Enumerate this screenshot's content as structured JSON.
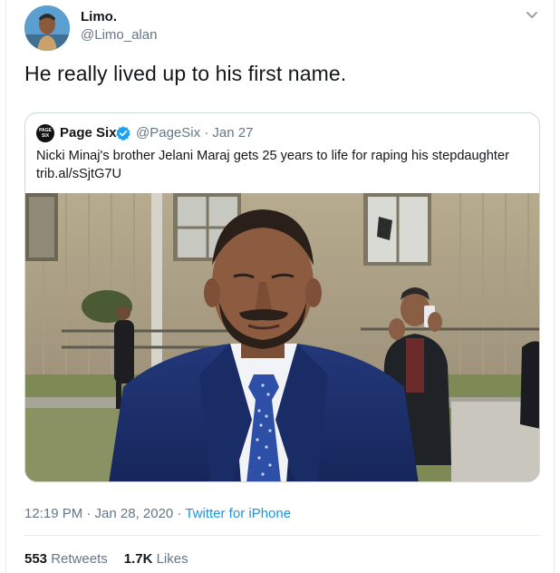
{
  "tweet": {
    "author": {
      "name": "Limo.",
      "handle": "@Limo_alan"
    },
    "text": "He really lived up to his first name.",
    "timestamp": "12:19 PM · Jan 28, 2020",
    "separator": " · ",
    "source": "Twitter for iPhone",
    "stats": {
      "retweets_count": "553",
      "retweets_label": "Retweets",
      "likes_count": "1.7K",
      "likes_label": "Likes"
    }
  },
  "quoted_tweet": {
    "author": {
      "name": "Page Six",
      "handle": "@PageSix · Jan 27",
      "logo_text": "PAGE SIX",
      "verified": true
    },
    "text": "Nicki Minaj's brother Jelani Maraj gets 25 years to life for raping his stepdaughter",
    "link": "trib.al/sSjtG7U"
  },
  "colors": {
    "link": "#1b95e0",
    "muted": "#657786",
    "border": "#ccd6dd",
    "verified": "#1da1f2"
  },
  "icons": {
    "caret": "chevron-down-icon",
    "verified": "verified-badge-icon"
  }
}
